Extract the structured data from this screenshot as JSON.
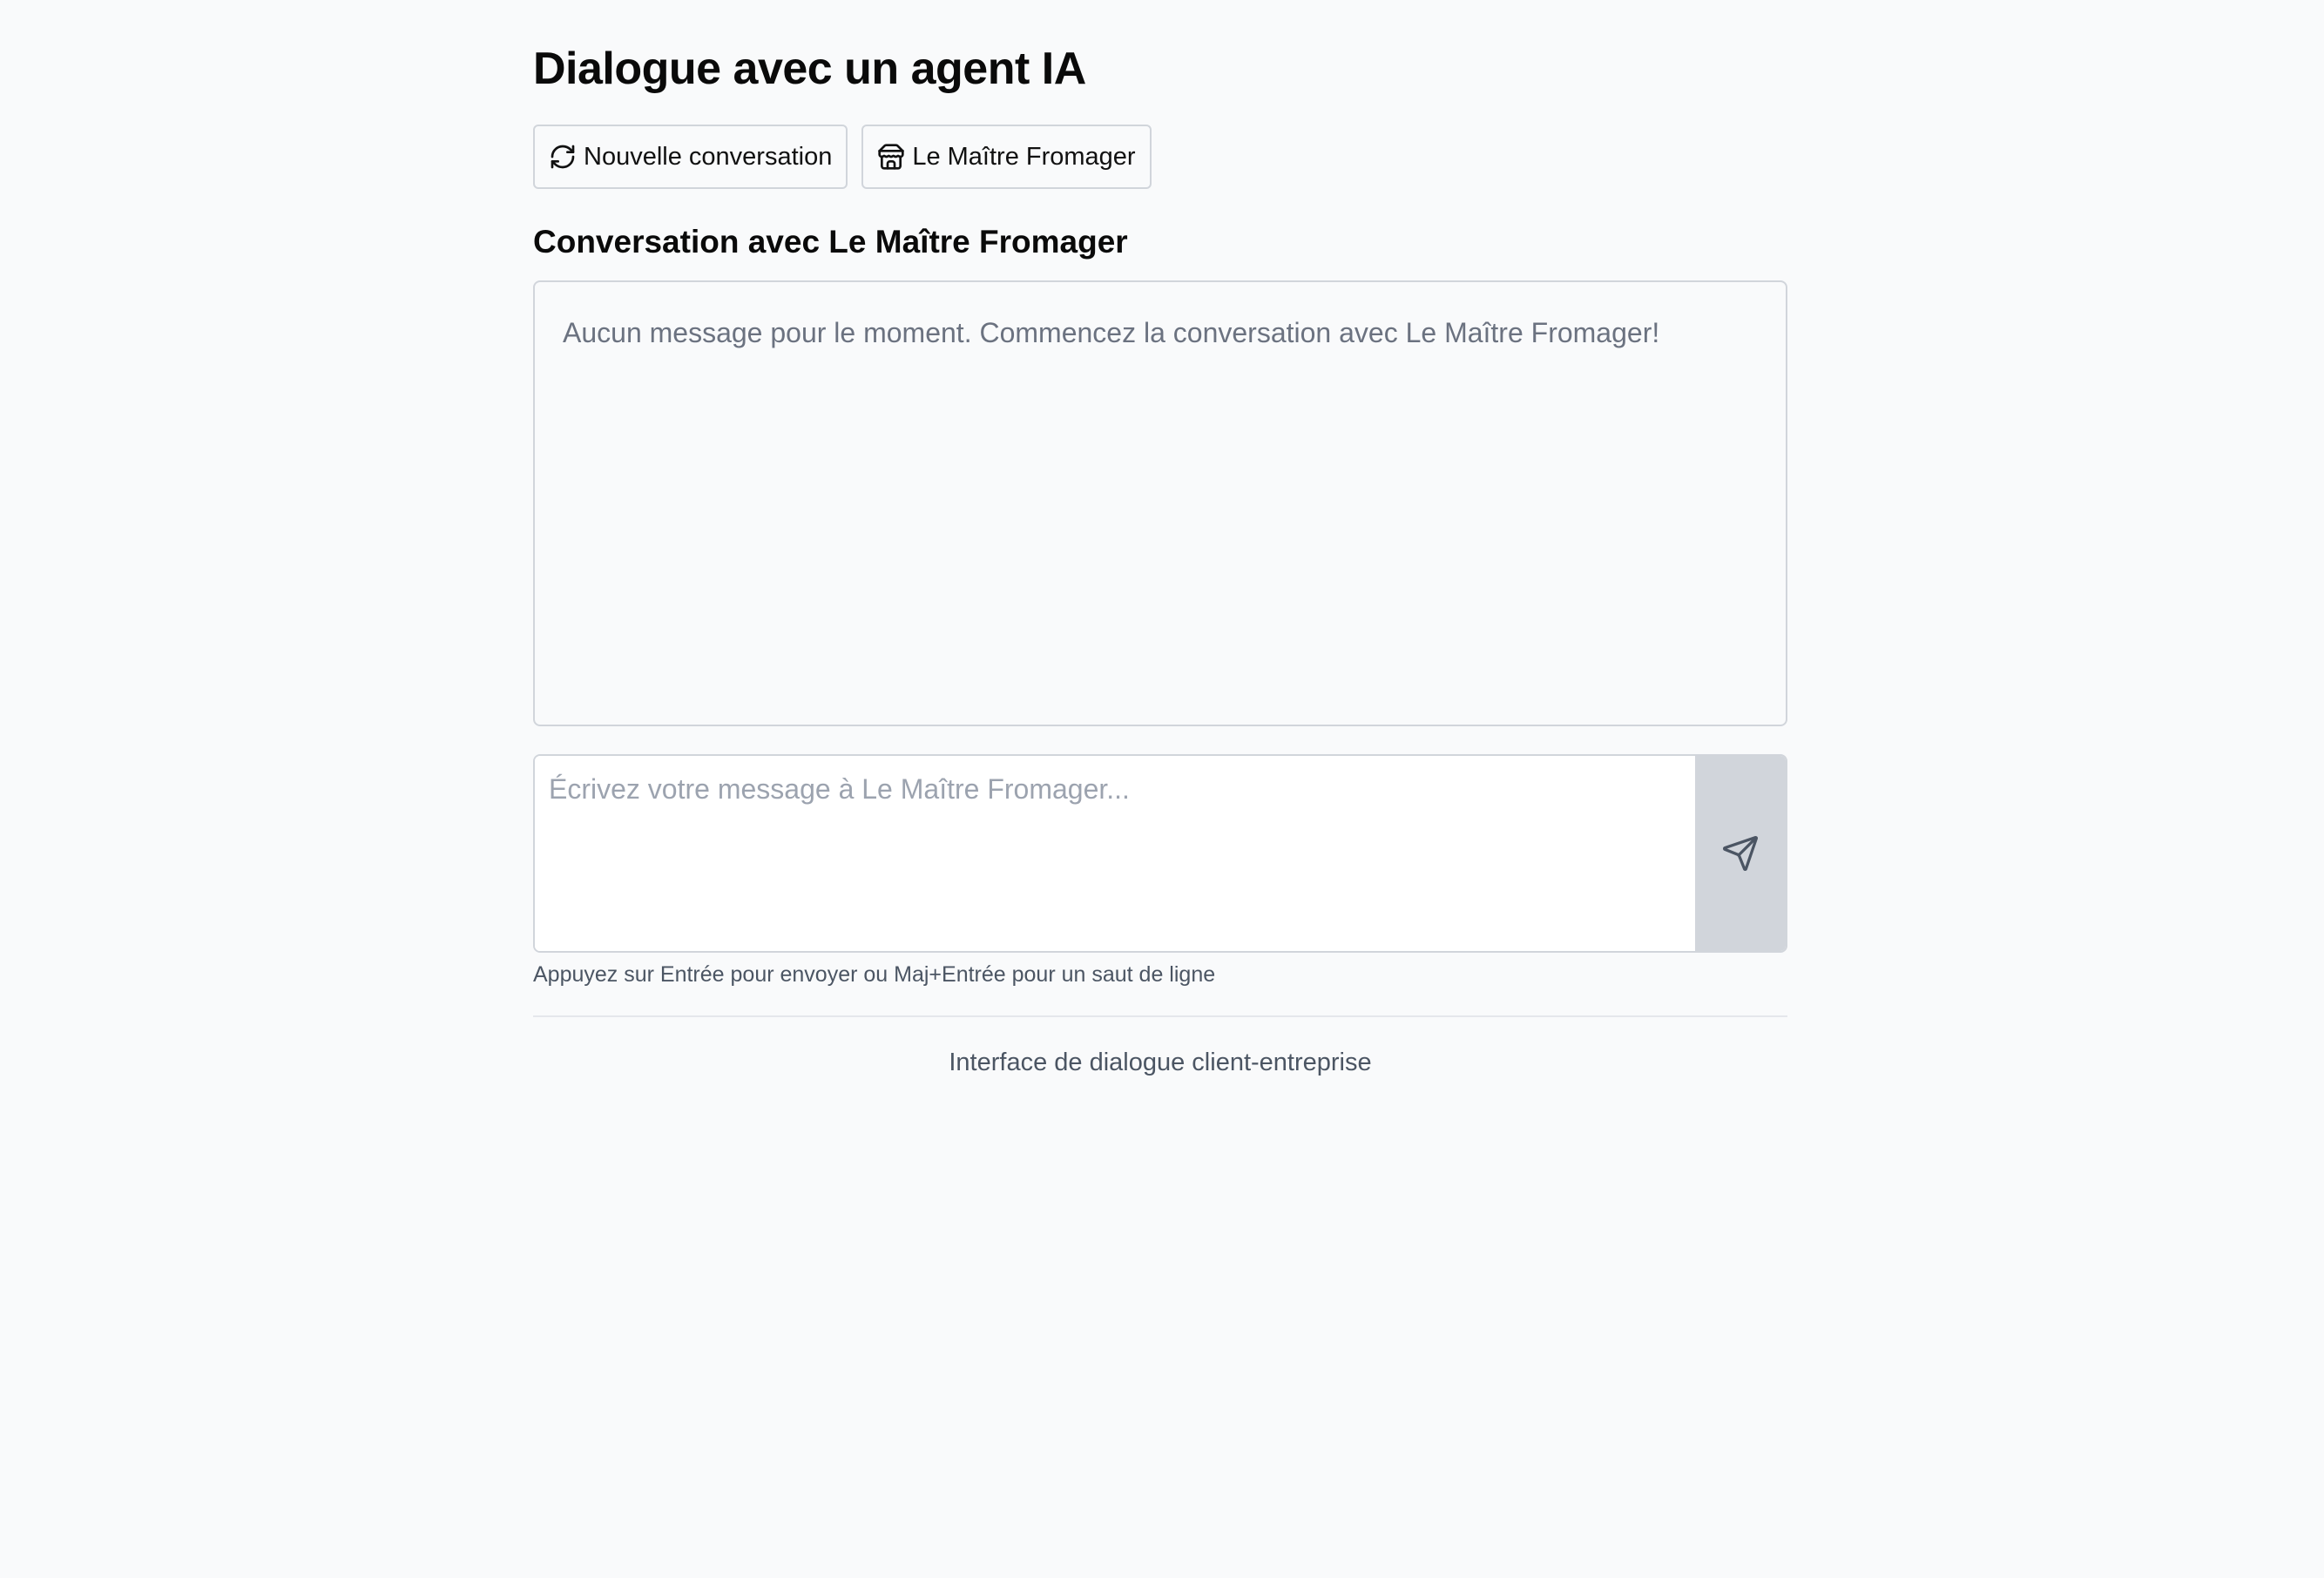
{
  "header": {
    "title": "Dialogue avec un agent IA"
  },
  "toolbar": {
    "new_conversation": {
      "label": "Nouvelle conversation",
      "icon": "refresh-icon"
    },
    "agent": {
      "label": "Le Maître Fromager",
      "icon": "store-icon"
    }
  },
  "conversation": {
    "title": "Conversation avec Le Maître Fromager",
    "empty_message": "Aucun message pour le moment. Commencez la conversation avec Le Maître Fromager!"
  },
  "composer": {
    "value": "",
    "placeholder": "Écrivez votre message à Le Maître Fromager...",
    "send_icon": "send-icon",
    "hint": "Appuyez sur Entrée pour envoyer ou Maj+Entrée pour un saut de ligne"
  },
  "footer": {
    "text": "Interface de dialogue client-entreprise"
  },
  "colors": {
    "background": "#f9fafb",
    "border": "#d1d5db",
    "muted_text": "#6b7280",
    "send_button": "#d1d5db"
  }
}
